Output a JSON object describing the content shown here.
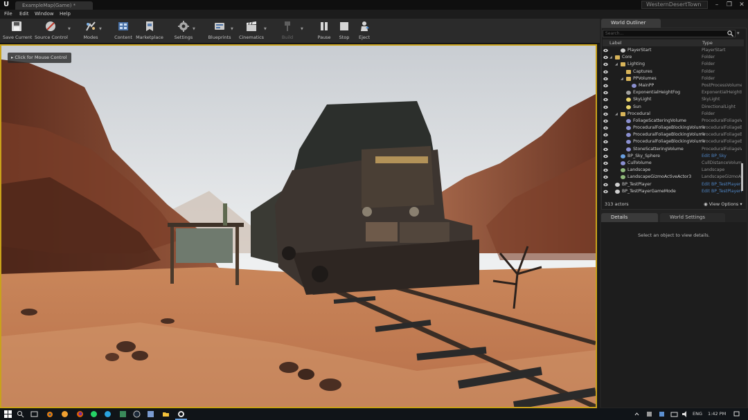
{
  "titlebar": {
    "tab_title": "ExampleMap(Game) *",
    "project_name": "WesternDesertTown",
    "minimize_glyph": "–",
    "maximize_glyph": "❐",
    "close_glyph": "✕"
  },
  "menu": {
    "file": "File",
    "edit": "Edit",
    "window": "Window",
    "help": "Help"
  },
  "toolbar": {
    "save_current": "Save Current",
    "source_control": "Source Control",
    "modes": "Modes",
    "content": "Content",
    "marketplace": "Marketplace",
    "settings": "Settings",
    "blueprints": "Blueprints",
    "cinematics": "Cinematics",
    "build": "Build",
    "pause": "Pause",
    "stop": "Stop",
    "eject": "Eject"
  },
  "viewport": {
    "hint": "Click for Mouse Control"
  },
  "outliner": {
    "tab_label": "World Outliner",
    "search_placeholder": "Search...",
    "col_label": "Label",
    "col_type": "Type",
    "rows": [
      {
        "label": "PlayerStart",
        "type": "PlayerStart",
        "indent": 2,
        "icon": "actor",
        "link": false
      },
      {
        "label": "Core",
        "type": "Folder",
        "indent": 1,
        "icon": "folder",
        "expanded": true,
        "link": false
      },
      {
        "label": "Lighting",
        "type": "Folder",
        "indent": 2,
        "icon": "folder",
        "expanded": true,
        "link": false
      },
      {
        "label": "Captures",
        "type": "Folder",
        "indent": 3,
        "icon": "folder",
        "link": false
      },
      {
        "label": "PPVolumes",
        "type": "Folder",
        "indent": 3,
        "icon": "folder",
        "expanded": true,
        "link": false
      },
      {
        "label": "MainPP",
        "type": "PostProcessVolume",
        "indent": 4,
        "icon": "volume",
        "link": false
      },
      {
        "label": "ExponentialHeightFog",
        "type": "ExponentialHeightFog",
        "indent": 3,
        "icon": "fog",
        "link": false
      },
      {
        "label": "SkyLight",
        "type": "SkyLight",
        "indent": 3,
        "icon": "light",
        "link": false
      },
      {
        "label": "Sun",
        "type": "DirectionalLight",
        "indent": 3,
        "icon": "light",
        "link": false
      },
      {
        "label": "Procedural",
        "type": "Folder",
        "indent": 2,
        "icon": "folder",
        "expanded": true,
        "link": false
      },
      {
        "label": "FoliageScatteringVolume",
        "type": "ProceduralFoliageVolume",
        "indent": 3,
        "icon": "volume",
        "link": false
      },
      {
        "label": "ProceduralFoliageBlockingVolume",
        "type": "ProceduralFoliageBlockingVolume",
        "indent": 3,
        "icon": "volume",
        "link": false
      },
      {
        "label": "ProceduralFoliageBlockingVolume",
        "type": "ProceduralFoliageBlockingVolume",
        "indent": 3,
        "icon": "volume",
        "link": false
      },
      {
        "label": "ProceduralFoliageBlockingVolume",
        "type": "ProceduralFoliageBlockingVolume",
        "indent": 3,
        "icon": "volume",
        "link": false
      },
      {
        "label": "StoneScatteringVolume",
        "type": "ProceduralFoliageVolume",
        "indent": 3,
        "icon": "volume",
        "link": false
      },
      {
        "label": "BP_Sky_Sphere",
        "type": "Edit BP_Sky",
        "indent": 2,
        "icon": "sphere",
        "link": true
      },
      {
        "label": "CullVolume",
        "type": "CullDistanceVolume",
        "indent": 2,
        "icon": "volume",
        "link": false
      },
      {
        "label": "Landscape",
        "type": "Landscape",
        "indent": 2,
        "icon": "landscape",
        "link": false
      },
      {
        "label": "LandscapeGizmoActiveActor3",
        "type": "LandscapeGizmoActiveActor",
        "indent": 2,
        "icon": "landscape",
        "link": false
      },
      {
        "label": "BP_TestPlayer",
        "type": "Edit BP_TestPlayer",
        "indent": 1,
        "icon": "actor",
        "link": true
      },
      {
        "label": "BP_TestPlayerGameMode",
        "type": "Edit BP_TestPlayerGameMode",
        "indent": 1,
        "icon": "actor",
        "link": true
      }
    ],
    "actor_count": "313 actors",
    "view_options": "View Options"
  },
  "details": {
    "tab_label": "Details",
    "world_settings_tab": "World Settings",
    "empty_message": "Select an object to view details."
  },
  "taskbar": {
    "lang": "ENG",
    "time": "1:42 PM"
  },
  "colors": {
    "accent_yellow": "#c9a21a",
    "link_blue": "#4f86c6",
    "panel_bg": "#1d1d1d",
    "toolbar_bg": "#2b2b2b"
  }
}
